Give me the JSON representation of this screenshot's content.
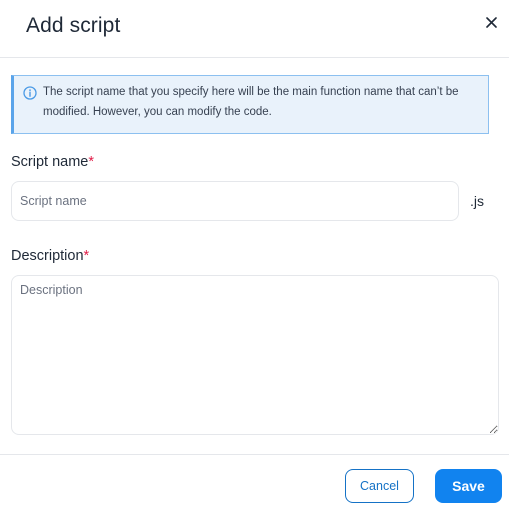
{
  "dialog": {
    "title": "Add script",
    "close_icon": "close-icon"
  },
  "info": {
    "icon": "info-icon",
    "text": "The script name that you specify here will be the main function name that can’t be modified. However, you can modify the code.",
    "colors": {
      "background": "#e9f2fb",
      "border": "#8cc0f0",
      "accent": "#5aa4ea"
    }
  },
  "fields": {
    "script_name": {
      "label": "Script name",
      "required_marker": "*",
      "value": "",
      "placeholder": "Script name",
      "suffix": ".js"
    },
    "description": {
      "label": "Description",
      "required_marker": "*",
      "value": "",
      "placeholder": "Description"
    }
  },
  "footer": {
    "cancel_label": "Cancel",
    "save_label": "Save"
  },
  "colors": {
    "primary": "#1183ef",
    "required": "#e11d48"
  }
}
